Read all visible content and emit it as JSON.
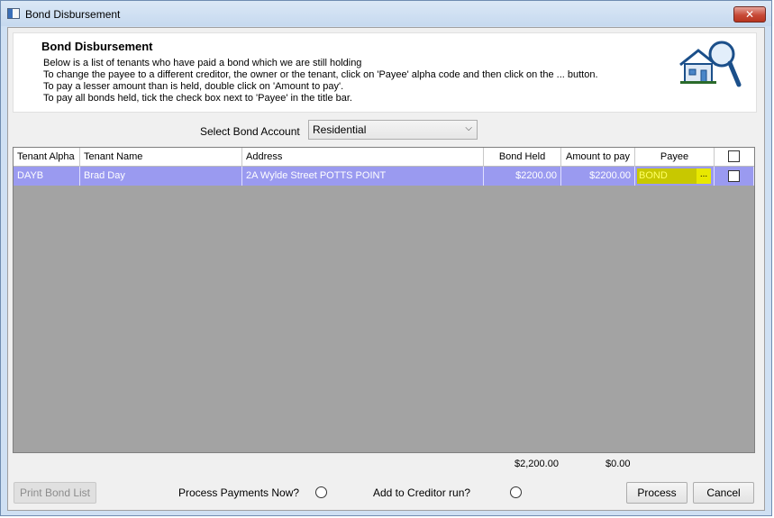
{
  "window": {
    "title": "Bond Disbursement",
    "close_glyph": "✕"
  },
  "header": {
    "title": "Bond Disbursement",
    "lines": [
      "Below is a list of tenants who have paid a bond which we are still holding",
      "To change the payee to a different creditor, the owner or the tenant, click on 'Payee' alpha code and then click on the ... button.",
      "To pay a lesser amount than is held, double click on 'Amount to pay'.",
      "To pay all bonds held, tick the check box next to 'Payee' in the title bar."
    ],
    "icon": "house-magnifier-icon"
  },
  "account": {
    "label": "Select Bond Account",
    "selected": "Residential",
    "chevron": "⌵"
  },
  "table": {
    "columns": [
      "Tenant Alpha",
      "Tenant Name",
      "Address",
      "Bond Held",
      "Amount to pay",
      "Payee"
    ],
    "rows": [
      {
        "alpha": "DAYB",
        "name": "Brad Day",
        "address": "2A Wylde Street POTTS POINT",
        "bond_held": "$2200.00",
        "amount": "$2200.00",
        "payee": "BOND",
        "payee_button": "..."
      }
    ],
    "totals": {
      "bond_held": "$2,200.00",
      "amount": "$0.00"
    }
  },
  "footer": {
    "print_label": "Print Bond List",
    "process_now_label": "Process Payments Now?",
    "creditor_label": "Add to Creditor run?",
    "process_label": "Process",
    "cancel_label": "Cancel"
  },
  "colors": {
    "row_selected": "#9a9af0",
    "payee_cell": "#c8c800",
    "grid_bg": "#a3a3a3"
  }
}
